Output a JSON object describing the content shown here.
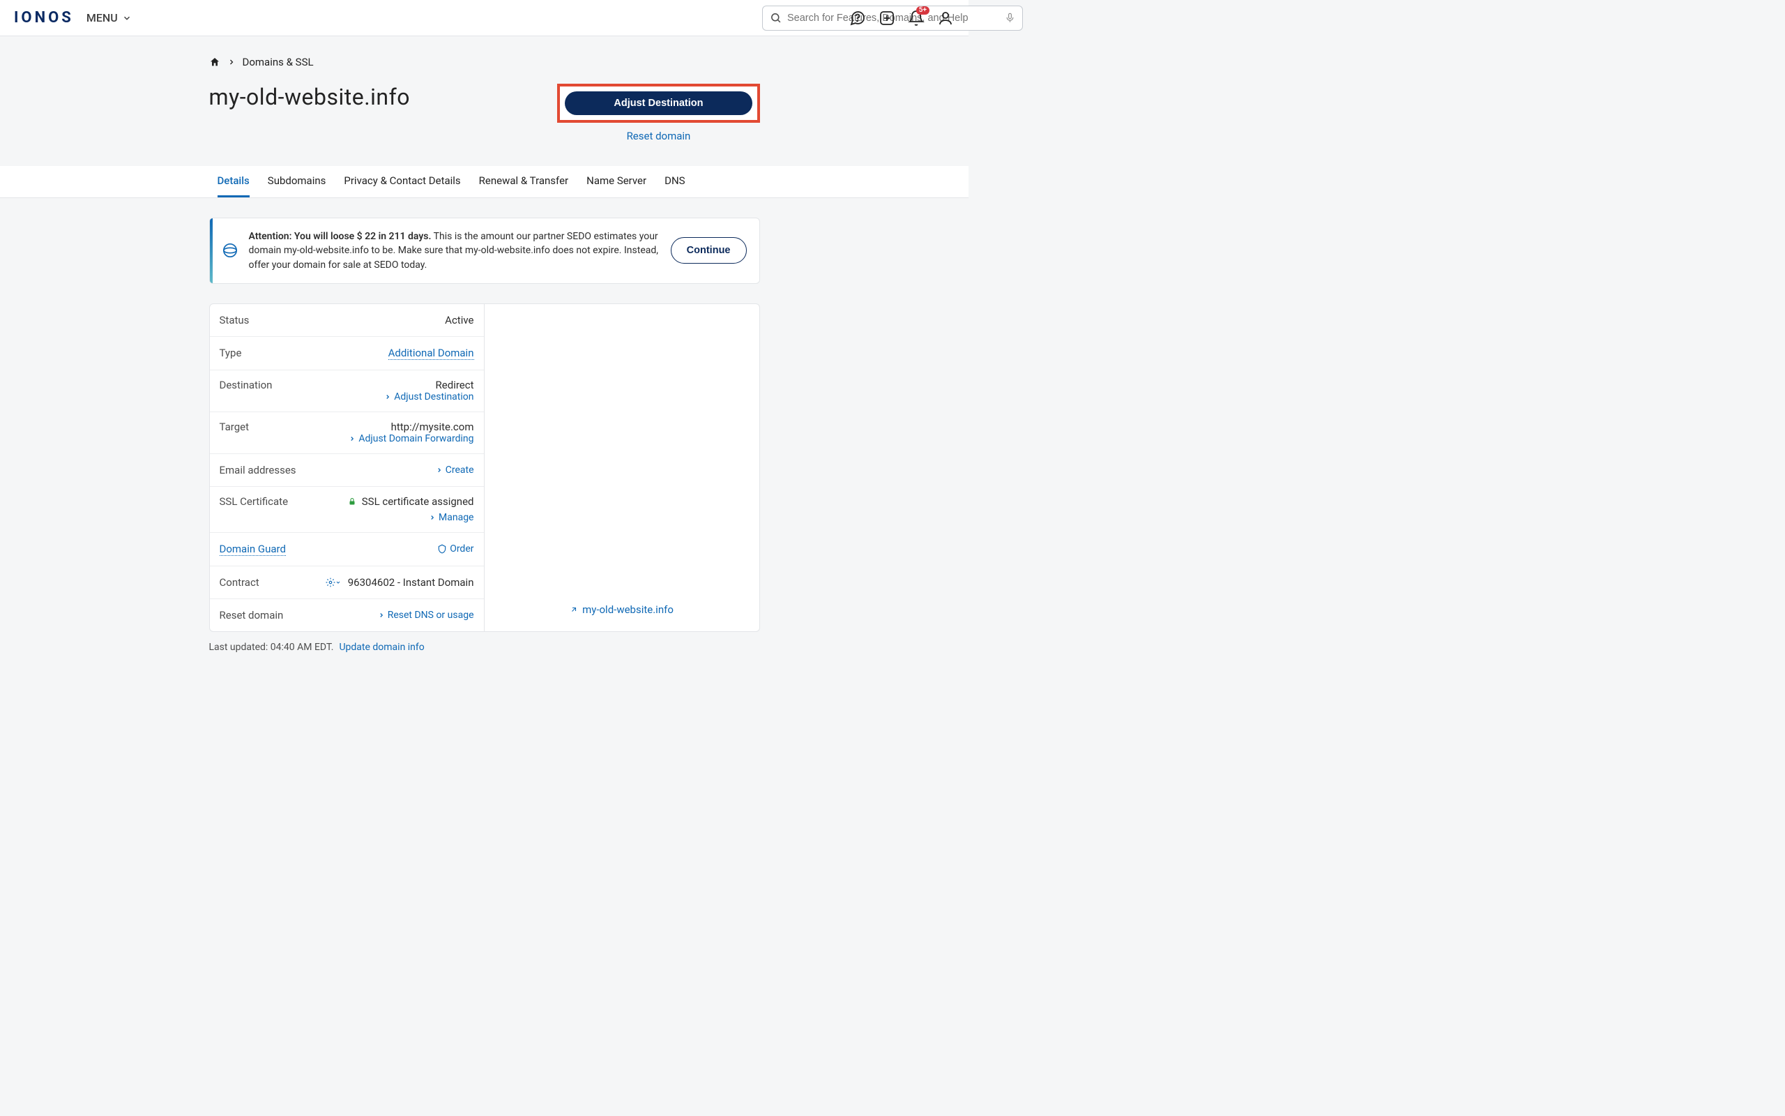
{
  "header": {
    "logo": "IONOS",
    "menu": "MENU",
    "search_placeholder": "Search for Features, Domains, and Help",
    "notif_badge": "5+"
  },
  "breadcrumb": {
    "item": "Domains & SSL"
  },
  "page_title": "my-old-website.info",
  "actions": {
    "adjust_btn": "Adjust Destination",
    "reset_link": "Reset domain"
  },
  "tabs": [
    {
      "label": "Details",
      "active": true
    },
    {
      "label": "Subdomains"
    },
    {
      "label": "Privacy & Contact Details"
    },
    {
      "label": "Renewal & Transfer"
    },
    {
      "label": "Name Server"
    },
    {
      "label": "DNS"
    }
  ],
  "notice": {
    "bold": "Attention: You will loose $ 22 in 211 days.",
    "rest": " This is the amount our partner SEDO estimates your domain my-old-website.info to be. Make sure that my-old-website.info does not expire. Instead, offer your domain for sale at SEDO today.",
    "btn": "Continue"
  },
  "details": {
    "status_label": "Status",
    "status_val": "Active",
    "type_label": "Type",
    "type_val": "Additional Domain",
    "dest_label": "Destination",
    "dest_val": "Redirect",
    "dest_action": "Adjust Destination",
    "target_label": "Target",
    "target_val": "http://mysite.com",
    "target_action": "Adjust Domain Forwarding",
    "email_label": "Email addresses",
    "email_action": "Create",
    "ssl_label": "SSL Certificate",
    "ssl_val": "SSL certificate assigned",
    "ssl_action": "Manage",
    "guard_label": "Domain Guard",
    "guard_action": "Order",
    "contract_label": "Contract",
    "contract_val": "96304602 - Instant Domain",
    "reset_label": "Reset domain",
    "reset_action": "Reset DNS or usage"
  },
  "side_link": "my-old-website.info",
  "footer": {
    "text": "Last updated: 04:40 AM EDT.",
    "link": "Update domain info"
  }
}
